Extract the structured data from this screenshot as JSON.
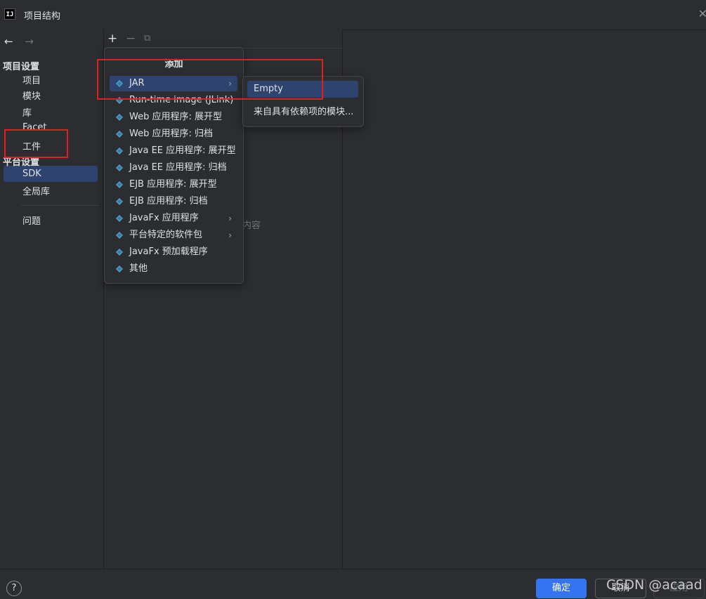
{
  "window": {
    "title": "项目结构",
    "app_icon": "IJ"
  },
  "nav": {
    "back_icon": "←",
    "forward_icon": "→"
  },
  "sidebar": {
    "section1_title": "项目设置",
    "section1_items": [
      "项目",
      "模块",
      "库",
      "Facet",
      "工件"
    ],
    "section2_title": "平台设置",
    "section2_items": [
      "SDK",
      "全局库"
    ],
    "section3_items": [
      "问题"
    ],
    "selected": "工件"
  },
  "toolbar": {
    "add": "+",
    "remove": "−",
    "copy": "⧉"
  },
  "main": {
    "empty_hint": "内容"
  },
  "add_menu": {
    "title": "添加",
    "items": [
      {
        "label": "JAR",
        "has_submenu": true,
        "selected": true,
        "icon": "diamond-icon"
      },
      {
        "label": "Run-time image (JLink)",
        "has_submenu": false,
        "icon": "diamond-icon"
      },
      {
        "label": "Web 应用程序: 展开型",
        "has_submenu": false,
        "icon": "web-module-icon"
      },
      {
        "label": "Web 应用程序: 归档",
        "has_submenu": false,
        "icon": "web-module-icon"
      },
      {
        "label": "Java EE 应用程序: 展开型",
        "has_submenu": false,
        "icon": "javaee-icon"
      },
      {
        "label": "Java EE 应用程序: 归档",
        "has_submenu": false,
        "icon": "javaee-icon"
      },
      {
        "label": "EJB 应用程序: 展开型",
        "has_submenu": false,
        "icon": "ejb-icon"
      },
      {
        "label": "EJB 应用程序: 归档",
        "has_submenu": false,
        "icon": "ejb-icon"
      },
      {
        "label": "JavaFx 应用程序",
        "has_submenu": true,
        "icon": "diamond-icon"
      },
      {
        "label": "平台特定的软件包",
        "has_submenu": true,
        "icon": "diamond-icon"
      },
      {
        "label": "JavaFx 预加载程序",
        "has_submenu": false,
        "icon": "diamond-icon"
      },
      {
        "label": "其他",
        "has_submenu": false,
        "icon": "diamond-icon"
      }
    ]
  },
  "jar_submenu": {
    "items": [
      "Empty",
      "来自具有依赖项的模块..."
    ],
    "selected": "Empty"
  },
  "footer": {
    "help": "?",
    "ok": "确定",
    "cancel": "取消",
    "apply": "应用"
  },
  "watermark": "CSDN @acaad",
  "colors": {
    "background": "#2b2d30",
    "selection": "#2e436e",
    "primary_button": "#3574f0",
    "annotation_red": "#e02020",
    "icon_blue": "#4a9fd8"
  }
}
